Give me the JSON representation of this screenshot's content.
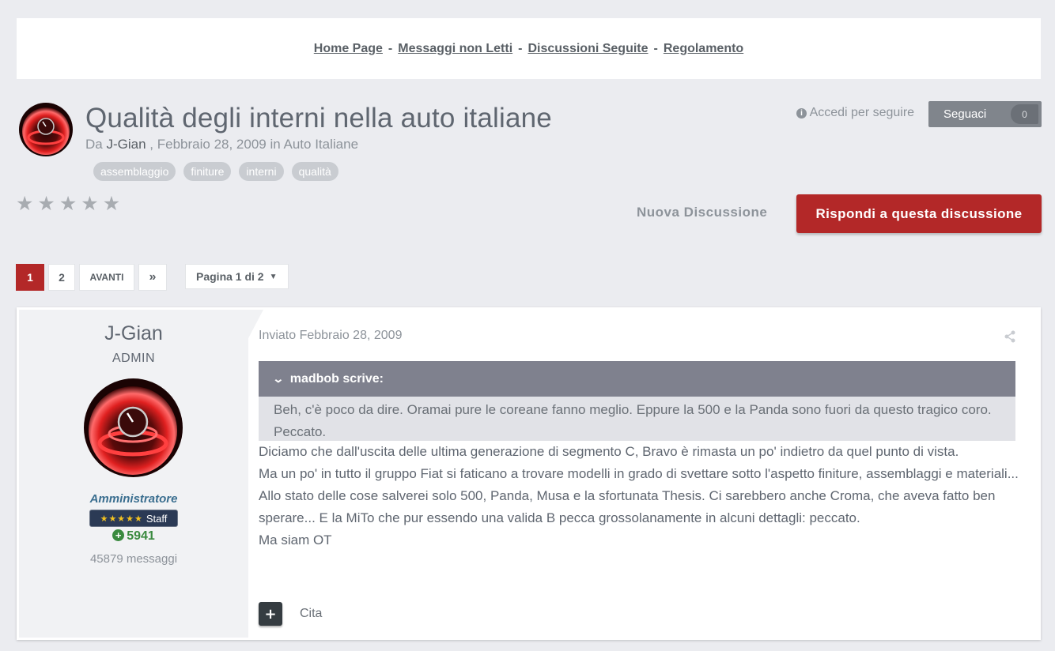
{
  "nav": {
    "links": [
      "Home Page",
      "Messaggi non Letti",
      "Discussioni Seguite",
      "Regolamento"
    ],
    "separator": "-"
  },
  "topic": {
    "title": "Qualità degli interni nella auto italiane",
    "by_prefix": "Da",
    "author": "J-Gian",
    "comma": ",",
    "date": "Febbraio 28, 2009",
    "in_word": "in",
    "forum": "Auto Italiane",
    "tags": [
      "assemblaggio",
      "finiture",
      "interni",
      "qualità"
    ],
    "rating_stars": 5,
    "rating_value": 0
  },
  "follow": {
    "login_text": "Accedi per seguire",
    "button_label": "Seguaci",
    "count": "0"
  },
  "actions": {
    "new_discussion": "Nuova Discussione",
    "reply": "Rispondi a questa discussione"
  },
  "pagination": {
    "pages": [
      "1",
      "2"
    ],
    "next": "AVANTI",
    "last_icon": "»",
    "jump_label": "Pagina 1 di 2"
  },
  "post": {
    "author": "J-Gian",
    "role": "ADMIN",
    "group": "Amministratore",
    "badge": "Staff",
    "badge_stars": "★★★★★",
    "reputation": "5941",
    "posts_count": "45879 messaggi",
    "posted_label": "Inviato Febbraio 28, 2009",
    "quote_author": "madbob scrive:",
    "quote_text": "Beh, c'è poco da dire. Oramai pure le coreane fanno meglio. Eppure la 500 e la Panda sono fuori da questo tragico coro. Peccato.",
    "paragraphs": [
      "Diciamo che dall'uscita delle ultima generazione di segmento C, Bravo è rimasta un po' indietro da quel punto di vista.",
      "Ma un po' in tutto il gruppo Fiat si faticano a trovare modelli in grado di svettare sotto l'aspetto finiture, assemblaggi e materiali...",
      "Allo stato delle cose salverei solo 500, Panda, Musa e la sfortunata Thesis. Ci sarebbero anche Croma, che aveva fatto ben sperare... E la MiTo che pur essendo una valida B pecca grossolanamente in alcuni dettagli: peccato.",
      "Ma siam OT"
    ],
    "quote_action": "Cita",
    "plus_icon": "+"
  },
  "colors": {
    "accent_red": "#b32828",
    "background": "#ebecf0",
    "quote_header": "#7f818e",
    "rep_green": "#3a8a3f"
  }
}
